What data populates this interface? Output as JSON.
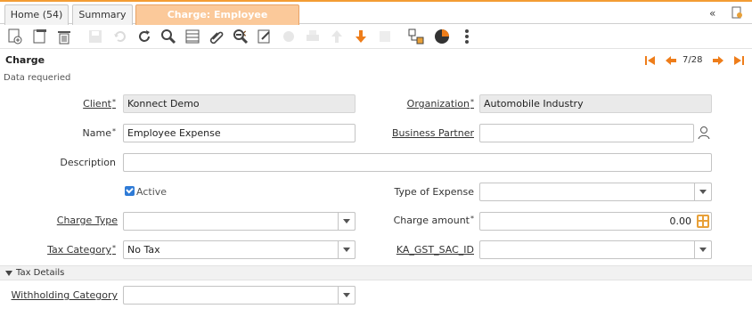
{
  "tabs": [
    {
      "label": "Home (54)"
    },
    {
      "label": "Summary"
    },
    {
      "label": "Charge: Employee Expense",
      "close": "×"
    }
  ],
  "tab_right": {
    "collapse": "«"
  },
  "header": {
    "title": "Charge",
    "pager": "7/28"
  },
  "message": "Data requeried",
  "form": {
    "client": {
      "label": "Client",
      "value": "Konnect Demo"
    },
    "organization": {
      "label": "Organization",
      "value": "Automobile Industry"
    },
    "name": {
      "label": "Name",
      "value": "Employee Expense"
    },
    "business_partner": {
      "label": "Business Partner",
      "value": ""
    },
    "description": {
      "label": "Description",
      "value": ""
    },
    "active": {
      "label": "Active",
      "checked": true
    },
    "type_of_expense": {
      "label": "Type of Expense",
      "value": ""
    },
    "charge_type": {
      "label": "Charge Type",
      "value": ""
    },
    "charge_amount": {
      "label": "Charge amount",
      "value": "0.00"
    },
    "tax_category": {
      "label": "Tax Category",
      "value": "No Tax"
    },
    "ka_gst_sac_id": {
      "label": "KA_GST_SAC_ID",
      "value": ""
    }
  },
  "section": {
    "title": "Tax Details"
  },
  "tax_details": {
    "withholding_category": {
      "label": "Withholding Category",
      "value": ""
    }
  },
  "required_mark": "*",
  "colors": {
    "accent": "#f39c34",
    "active_tab": "#fbc99a",
    "checkbox": "#2f7bd6"
  }
}
